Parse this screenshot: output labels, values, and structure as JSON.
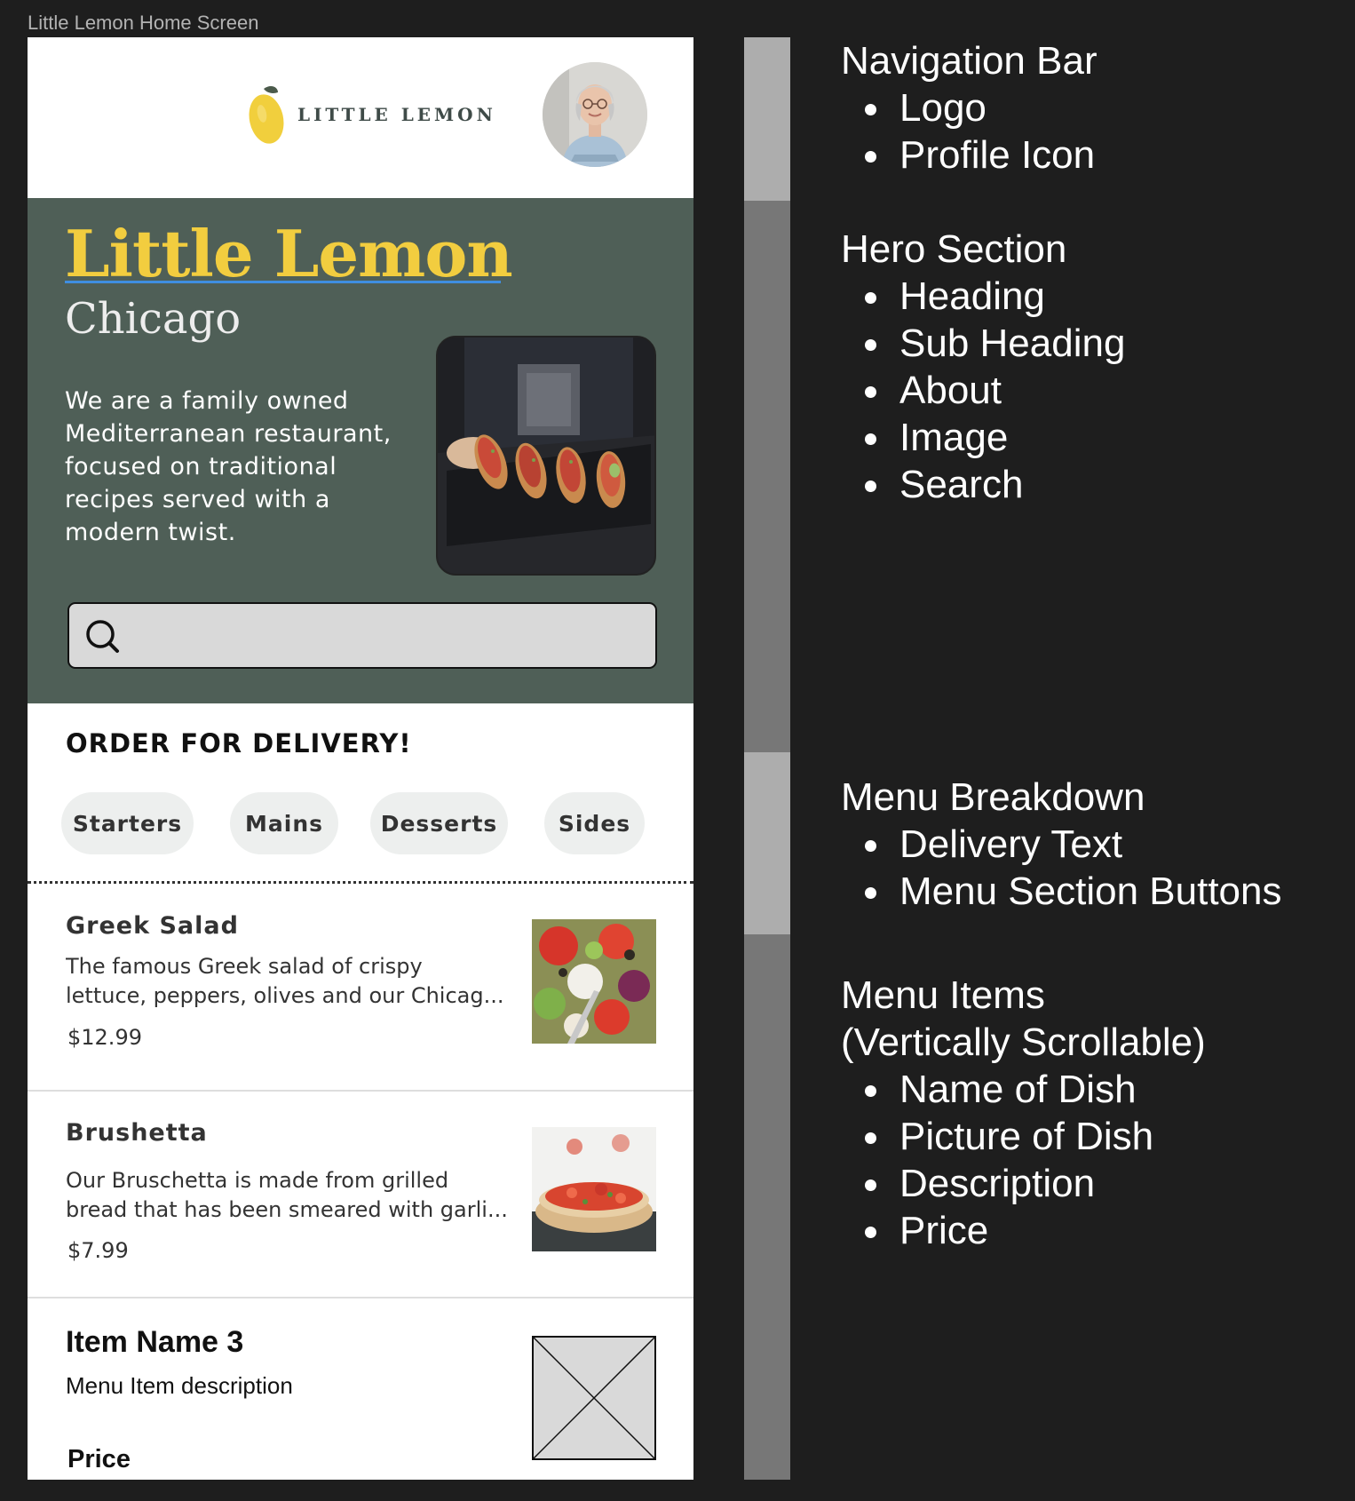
{
  "frame_label": "Little Lemon Home Screen",
  "navbar": {
    "logo_text": "LITTLE LEMON",
    "logo_icon": "lemon-icon",
    "profile_icon": "avatar"
  },
  "hero": {
    "heading": "Little Lemon",
    "sub_heading": "Chicago",
    "about": "We are a family owned Mediterranean restaurant, focused on traditional recipes served with a modern twist.",
    "image_icon": "bruschetta-photo",
    "search": {
      "icon": "search-icon",
      "placeholder": ""
    }
  },
  "menu_breakdown": {
    "delivery_text": "ORDER FOR DELIVERY!",
    "buttons": [
      "Starters",
      "Mains",
      "Desserts",
      "Sides"
    ]
  },
  "menu_items": [
    {
      "name": "Greek Salad",
      "description_lines": [
        "The famous Greek salad of crispy",
        "lettuce, peppers, olives and our Chicag..."
      ],
      "price": "$12.99"
    },
    {
      "name": "Brushetta",
      "description_lines": [
        "Our Bruschetta is made from grilled",
        "bread that has been smeared with garli..."
      ],
      "price": "$7.99"
    },
    {
      "name": "Item Name 3",
      "description": "Menu Item description",
      "price": "Price"
    }
  ],
  "annotations": {
    "navigation_bar": {
      "title": "Navigation Bar",
      "items": [
        "Logo",
        "Profile Icon"
      ]
    },
    "hero_section": {
      "title": "Hero Section",
      "items": [
        "Heading",
        "Sub Heading",
        "About",
        "Image",
        "Search"
      ]
    },
    "menu_breakdown": {
      "title": "Menu Breakdown",
      "items": [
        "Delivery Text",
        "Menu Section Buttons"
      ]
    },
    "menu_items": {
      "title_lines": [
        "Menu Items",
        "(Vertically Scrollable)"
      ],
      "items": [
        "Name of Dish",
        "Picture of Dish",
        "Description",
        "Price"
      ]
    }
  },
  "colors": {
    "background": "#1e1e1e",
    "hero_green": "#4f5f57",
    "lemon_yellow": "#f2cd3f",
    "pill_gray": "#edefee",
    "bar_light": "#adadad",
    "bar_dark": "#777777"
  }
}
